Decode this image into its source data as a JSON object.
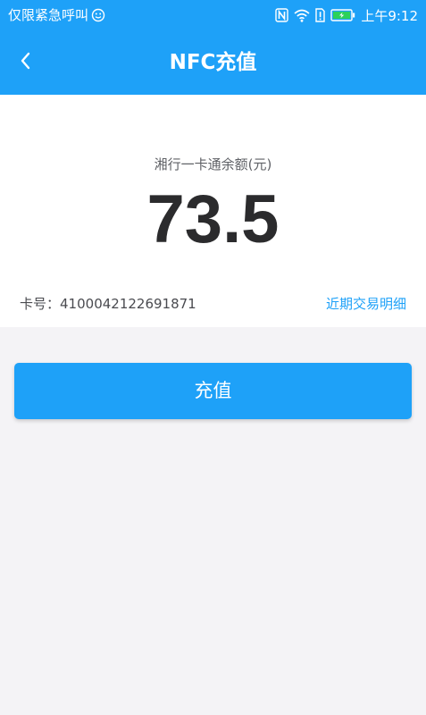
{
  "colors": {
    "accent": "#1ea1f8",
    "page_background": "#f4f3f6",
    "card_background": "#ffffff",
    "balance_text": "#2b2b2d"
  },
  "status_bar": {
    "carrier_text": "仅限紧急呼叫",
    "time": "上午9:12",
    "icons": [
      "emoji-icon",
      "nfc-icon",
      "wifi-icon",
      "sim-alert-icon",
      "battery-charging-icon"
    ]
  },
  "header": {
    "back_icon": "chevron-left-icon",
    "title": "NFC充值"
  },
  "balance": {
    "label": "湘行一卡通余额(元)",
    "value": "73.5"
  },
  "card": {
    "number_label": "卡号：",
    "number": "4100042122691871",
    "records_link": "近期交易明细"
  },
  "actions": {
    "recharge_label": "充值"
  }
}
